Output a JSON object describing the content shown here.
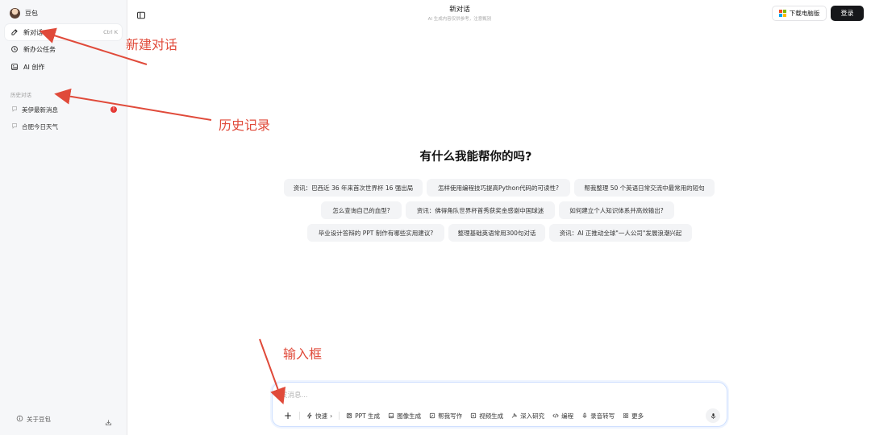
{
  "sidebar": {
    "brand": "豆包",
    "items": [
      {
        "label": "新对话",
        "shortcut": "Ctrl K",
        "icon": "edit-icon"
      },
      {
        "label": "新办公任务",
        "icon": "task-icon"
      },
      {
        "label": "AI 创作",
        "icon": "image-create-icon"
      }
    ],
    "history_label": "历史对话",
    "history": [
      {
        "label": "美伊最新消息",
        "badge": "!"
      },
      {
        "label": "合肥今日天气"
      }
    ],
    "about": "关于豆包"
  },
  "header": {
    "title": "新对话",
    "subtitle": "AI 生成内容仅供参考，注意甄别",
    "download_label": "下载电脑版",
    "login_label": "登录"
  },
  "main": {
    "headline": "有什么我能帮你的吗?",
    "suggestions": [
      "资讯：巴西近 36 年来首次世界杯 16 强出局",
      "怎样使用编程技巧提高Python代码的可读性?",
      "帮我整理 50 个英语日常交流中最常用的短句",
      "怎么查询自己的血型?",
      "资讯：佛得角队世界杯首秀获奖金感谢中国球迷",
      "如何建立个人知识体系并高效输出?",
      "毕业设计答辩的 PPT 制作有哪些实用建议?",
      "整理基础英语常用300句对话",
      "资讯：AI 正推动全球\"一人公司\"发展浪潮兴起"
    ]
  },
  "input": {
    "placeholder": "发消息...",
    "tools": [
      {
        "label": "快速",
        "icon": "lightning-icon"
      },
      {
        "label": "PPT 生成",
        "icon": "ppt-icon"
      },
      {
        "label": "图像生成",
        "icon": "image-icon"
      },
      {
        "label": "帮我写作",
        "icon": "write-icon"
      },
      {
        "label": "视频生成",
        "icon": "video-icon"
      },
      {
        "label": "深入研究",
        "icon": "research-icon"
      },
      {
        "label": "编程",
        "icon": "code-icon"
      },
      {
        "label": "录音转写",
        "icon": "record-icon"
      },
      {
        "label": "更多",
        "icon": "grid-icon"
      }
    ]
  },
  "annotations": {
    "new_chat": "新建对话",
    "history": "历史记录",
    "input_box": "输入框",
    "color": "#e04a3a"
  },
  "colors": {
    "accent_dark": "#16171a",
    "sidebar_bg": "#f6f7f9",
    "chip_bg": "#f3f4f6",
    "badge": "#e53935"
  }
}
